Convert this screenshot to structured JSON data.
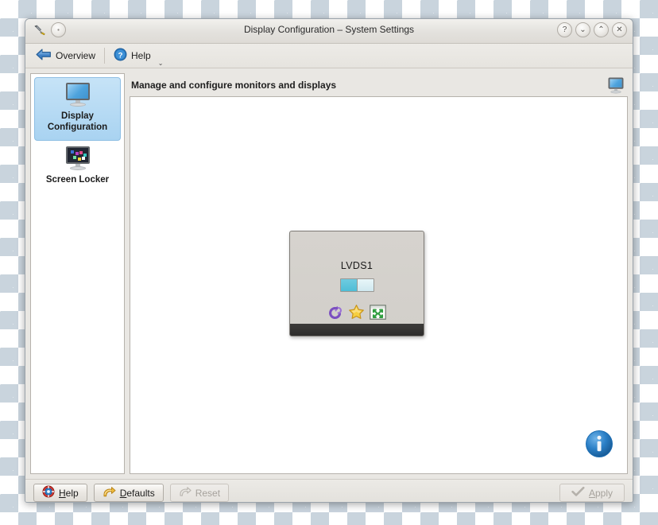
{
  "window": {
    "title": "Display Configuration – System Settings",
    "titlebar_left_icons": [
      "tools-icon",
      "shade-button"
    ],
    "titlebar_buttons": [
      {
        "name": "help-button",
        "glyph": "?"
      },
      {
        "name": "minimize-button",
        "glyph": "⌄"
      },
      {
        "name": "maximize-button",
        "glyph": "⌃"
      },
      {
        "name": "close-button",
        "glyph": "✕"
      }
    ]
  },
  "toolbar": {
    "overview_label": "Overview",
    "help_label": "Help",
    "dropdown_glyph": "⌄"
  },
  "sidebar": {
    "items": [
      {
        "label": "Display\nConfiguration",
        "label_line1": "Display",
        "label_line2": "Configuration",
        "icon": "monitor-icon",
        "selected": true
      },
      {
        "label": "Screen Locker",
        "label_line1": "Screen Locker",
        "label_line2": "",
        "icon": "monitor-locker-icon",
        "selected": false
      }
    ]
  },
  "main": {
    "header_title": "Manage and configure monitors and displays",
    "header_icon": "monitor-icon",
    "info_icon": "info-icon"
  },
  "screen_widget": {
    "name": "LVDS1",
    "toggle_state": "on",
    "actions": [
      {
        "name": "rotate-icon",
        "title": "Rotate"
      },
      {
        "name": "primary-star-icon",
        "title": "Primary"
      },
      {
        "name": "resolution-icon",
        "title": "Resolution"
      }
    ]
  },
  "footer": {
    "help_label": "Help",
    "defaults_label": "Defaults",
    "reset_label": "Reset",
    "apply_label": "Apply",
    "reset_disabled": true,
    "apply_disabled": true
  },
  "colors": {
    "selection_blue": "#a9d3f1",
    "toggle_on": "#4fbdd6",
    "info_blue": "#1e6fb8",
    "widget_gray": "#d4d1cc"
  }
}
